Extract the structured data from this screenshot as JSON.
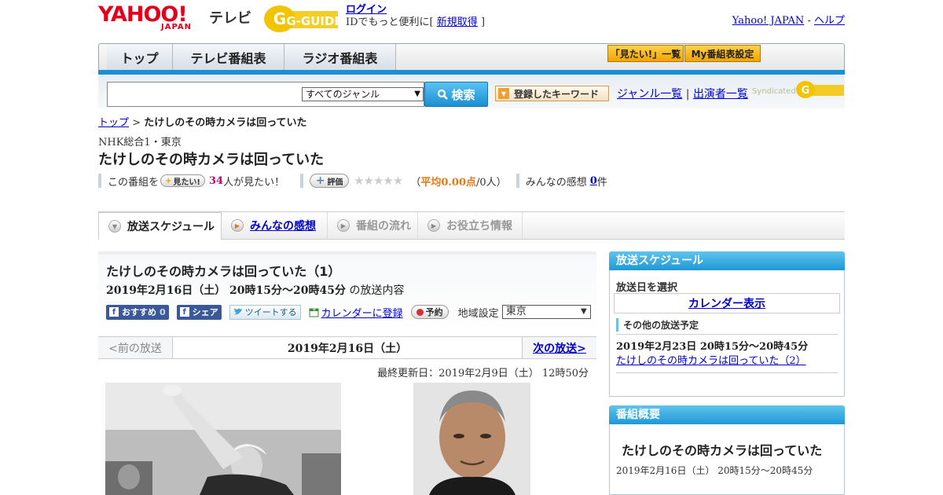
{
  "header": {
    "yahoo_logo": "YAHOO!",
    "japan_logo": "JAPAN",
    "tv_logo": "テレビ",
    "gguide_logo": "G-GUIDE",
    "login_link": "ログイン",
    "login_prefix": "IDでもっと便利に[",
    "register_link": "新規取得",
    "login_suffix": "]",
    "yahoo_japan_link": "Yahoo! JAPAN",
    "link_sep": " - ",
    "help_link": "ヘルプ"
  },
  "mainnav": {
    "tabs": [
      "トップ",
      "テレビ番組表",
      "ラジオ番組表"
    ],
    "want_list_btn": "「見たい!」一覧",
    "my_schedule_btn": "My番組表設定"
  },
  "search": {
    "genre_selected": "すべてのジャンル",
    "search_btn": "検索",
    "keyword_btn": "登録したキーワード",
    "genre_list_link": "ジャンル一覧",
    "sep": "|",
    "cast_list_link": "出演者一覧",
    "syndicated": "Syndicated"
  },
  "breadcrumb": {
    "top": "トップ",
    "sep": " > ",
    "current": "たけしのその時カメラは回っていた"
  },
  "program": {
    "station": "NHK総合1・東京",
    "title": "たけしのその時カメラは回っていた",
    "this_program": "この番組を",
    "want_btn": "見たい!",
    "want_count": "34",
    "want_suffix": "人が見たい！",
    "rate_btn": "評価",
    "stars": "★★★★★",
    "avg_open": "（",
    "avg_label": "平均",
    "avg_value": "0.00点",
    "avg_suffix": "/0人）",
    "impressions_label": "みんなの感想",
    "impressions_count": "0",
    "impressions_suffix": "件"
  },
  "tabs": {
    "schedule": "放送スケジュール",
    "impressions": "みんなの感想",
    "flow": "番組の流れ",
    "info": "お役立ち情報"
  },
  "episode": {
    "title": "たけしのその時カメラは回っていた（1）",
    "datetime": "2019年2月16日（土） 20時15分～20時45分",
    "datetime_suffix": " の放送内容",
    "recommend_btn": "おすすめ",
    "recommend_count": "0",
    "share_btn": "シェア",
    "tweet_btn": "ツイートする",
    "calendar_link": "カレンダーに登録",
    "reserve_btn": "予約",
    "region_label": "地域設定",
    "region_selected": "東京",
    "prev": "<前の放送",
    "current_date": "2019年2月16日（土）",
    "next": "次の放送>",
    "updated": "最終更新日：2019年2月9日（土） 12時50分"
  },
  "sidebar": {
    "schedule_head": "放送スケジュール",
    "select_date": "放送日を選択",
    "calendar_link": "カレンダー表示",
    "other_label": "その他の放送予定",
    "other_date": "2019年2月23日 20時15分～20時45分",
    "other_link": "たけしのその時カメラは回っていた（2）",
    "summary_head": "番組概要",
    "summary_title": "たけしのその時カメラは回っていた",
    "summary_time": "2019年2月16日（土） 20時15分～20時45分"
  },
  "colors": {
    "yahoo_red": "#e2001a",
    "nav_blue": "#1a8fd6",
    "want_count_pink": "#cc0066",
    "avg_orange": "#e8770e"
  }
}
